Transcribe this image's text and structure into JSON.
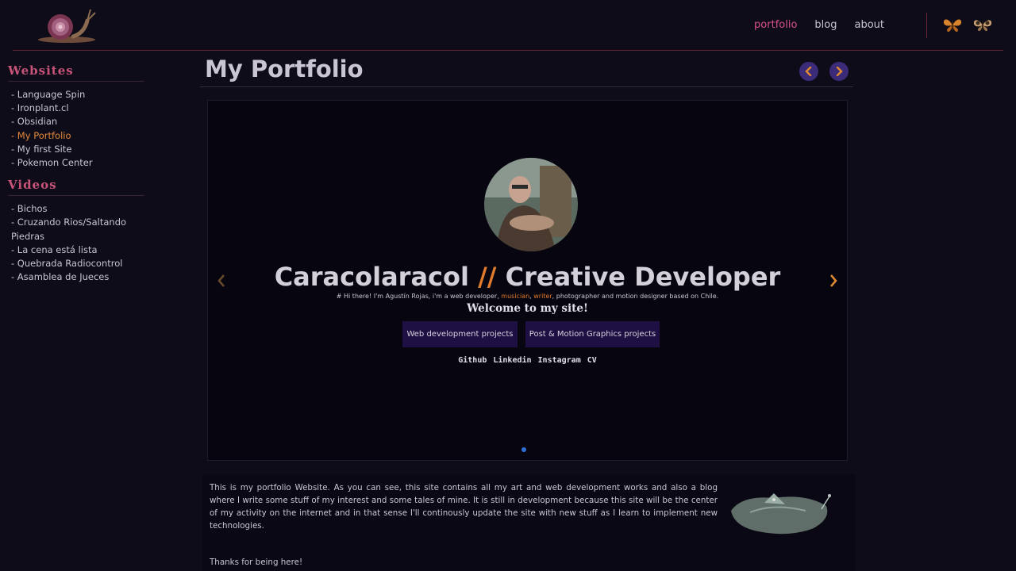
{
  "nav": {
    "portfolio": "portfolio",
    "blog": "blog",
    "about": "about"
  },
  "sidebar": {
    "websites_title": "Websites",
    "websites": [
      "- Language Spin",
      "- Ironplant.cl",
      "- Obsidian",
      "- My Portfolio",
      "- My first Site",
      "- Pokemon Center"
    ],
    "videos_title": "Videos",
    "videos": [
      "- Bichos",
      "- Cruzando Rios/Saltando Piedras",
      "- La cena está lista",
      "- Quebrada Radiocontrol",
      "- Asamblea de Jueces"
    ]
  },
  "main": {
    "title": "My Portfolio"
  },
  "hero": {
    "title_a": "Caracolaracol",
    "title_sep": "//",
    "title_b": "Creative Developer",
    "sub_1": "# Hi there! I'm Agustín Rojas, i'm a web developer,",
    "sub_musician": "musician",
    "sub_comma": ",",
    "sub_writer": "writer",
    "sub_2": ", photographer and motion designer based on Chile.",
    "welcome": "Welcome to my site!",
    "btn_web": "Web development projects",
    "btn_motion": "Post & Motion Graphics projects",
    "links": [
      "Github",
      "Linkedin",
      "Instagram",
      "CV"
    ]
  },
  "description": {
    "text": "This is my portfolio Website. As you can see, this site contains all my art and web development works and also a blog where I write some stuff of my interest and some tales of mine. It is still in development because this site will be the center of my activity on the internet and in that sense I'll continously update the site with new stuff as I learn to implement new technologies.",
    "thanks": "Thanks for being here!"
  },
  "colors": {
    "accent_pink": "#d6508a",
    "accent_orange": "#e07a2c",
    "button_purple": "#3b2b78",
    "dot_blue": "#2d6fd8"
  },
  "icons": {
    "logo": "snail-logo-icon",
    "theme_a": "butterfly-icon",
    "theme_b": "moth-icon"
  }
}
